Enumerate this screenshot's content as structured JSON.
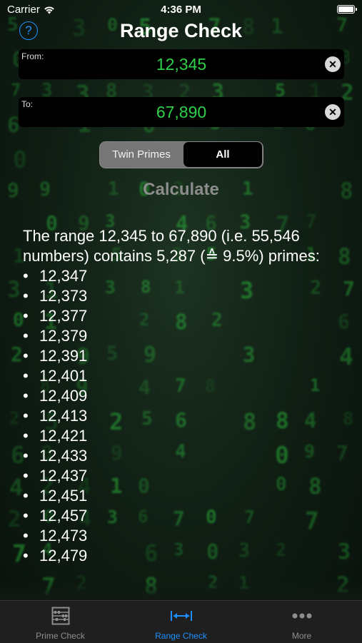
{
  "status_bar": {
    "carrier": "Carrier",
    "time": "4:36 PM"
  },
  "nav": {
    "title": "Range Check",
    "help_icon": "?"
  },
  "from_field": {
    "label": "From:",
    "value": "12,345"
  },
  "to_field": {
    "label": "To:",
    "value": "67,890"
  },
  "segmented": {
    "options": [
      "Twin Primes",
      "All"
    ],
    "selected": "All"
  },
  "calculate_label": "Calculate",
  "result": {
    "summary": "The range 12,345 to 67,890 (i.e. 55,546 numbers) contains 5,287 (≙ 9.5%) primes:",
    "bullet": "•",
    "primes": [
      "12,347",
      "12,373",
      "12,377",
      "12,379",
      "12,391",
      "12,401",
      "12,409",
      "12,413",
      "12,421",
      "12,433",
      "12,437",
      "12,451",
      "12,457",
      "12,473",
      "12,479"
    ]
  },
  "tabs": [
    {
      "label": "Prime Check",
      "icon": "abacus-icon",
      "active": false
    },
    {
      "label": "Range Check",
      "icon": "range-arrows-icon",
      "active": true
    },
    {
      "label": "More",
      "icon": "more-dots-icon",
      "active": false
    }
  ],
  "colors": {
    "accent": "#1e90ff",
    "value_green": "#2fd14a",
    "calculate_disabled": "#8c8c8c"
  }
}
